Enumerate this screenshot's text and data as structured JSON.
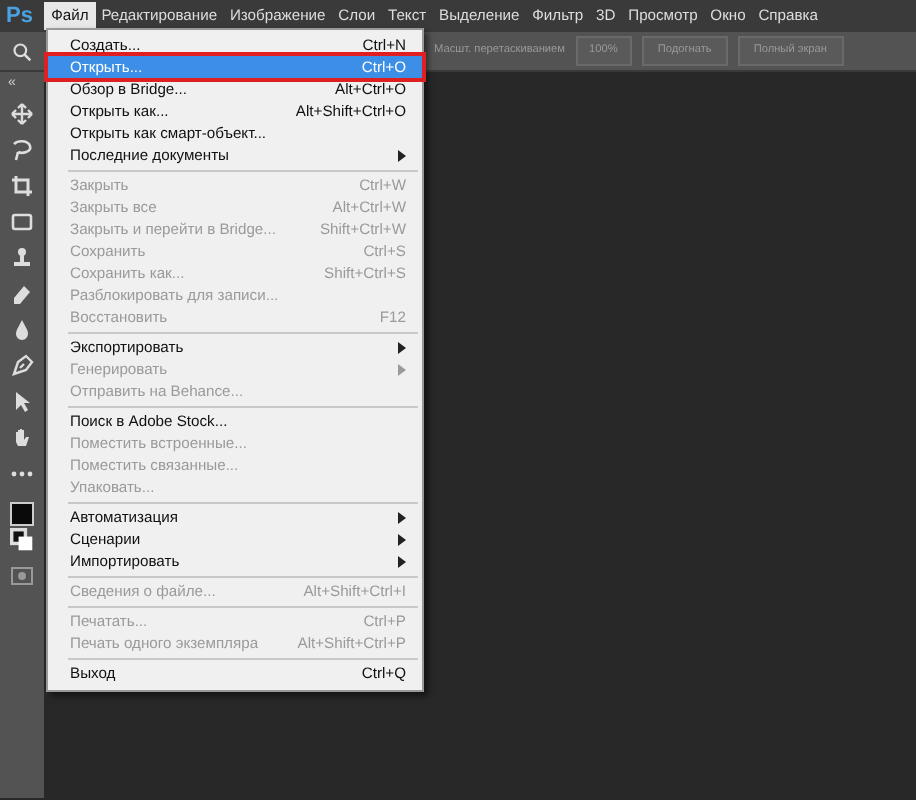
{
  "app_logo": "Ps",
  "menubar": [
    {
      "label": "Файл",
      "selected": true
    },
    {
      "label": "Редактирование",
      "selected": false
    },
    {
      "label": "Изображение",
      "selected": false
    },
    {
      "label": "Слои",
      "selected": false
    },
    {
      "label": "Текст",
      "selected": false
    },
    {
      "label": "Выделение",
      "selected": false
    },
    {
      "label": "Фильтр",
      "selected": false
    },
    {
      "label": "3D",
      "selected": false
    },
    {
      "label": "Просмотр",
      "selected": false
    },
    {
      "label": "Окно",
      "selected": false
    },
    {
      "label": "Справка",
      "selected": false
    }
  ],
  "options_bar": {
    "checkbox_label": "Масшт. перетаскиванием",
    "buttons": [
      "100%",
      "Подогнать",
      "Полный экран"
    ]
  },
  "panel_collapse": "«",
  "file_menu": [
    {
      "kind": "item",
      "label": "Создать...",
      "shortcut": "Ctrl+N",
      "disabled": false,
      "selected": false,
      "submenu": false,
      "annotated": false
    },
    {
      "kind": "item",
      "label": "Открыть...",
      "shortcut": "Ctrl+O",
      "disabled": false,
      "selected": true,
      "submenu": false,
      "annotated": true
    },
    {
      "kind": "item",
      "label": "Обзор в Bridge...",
      "shortcut": "Alt+Ctrl+O",
      "disabled": false,
      "selected": false,
      "submenu": false,
      "annotated": false
    },
    {
      "kind": "item",
      "label": "Открыть как...",
      "shortcut": "Alt+Shift+Ctrl+O",
      "disabled": false,
      "selected": false,
      "submenu": false,
      "annotated": false
    },
    {
      "kind": "item",
      "label": "Открыть как смарт-объект...",
      "disabled": false,
      "selected": false,
      "submenu": false,
      "annotated": false
    },
    {
      "kind": "item",
      "label": "Последние документы",
      "disabled": false,
      "selected": false,
      "submenu": true,
      "annotated": false
    },
    {
      "kind": "separator"
    },
    {
      "kind": "item",
      "label": "Закрыть",
      "shortcut": "Ctrl+W",
      "disabled": true,
      "selected": false,
      "submenu": false,
      "annotated": false
    },
    {
      "kind": "item",
      "label": "Закрыть все",
      "shortcut": "Alt+Ctrl+W",
      "disabled": true,
      "selected": false,
      "submenu": false,
      "annotated": false
    },
    {
      "kind": "item",
      "label": "Закрыть и перейти в Bridge...",
      "shortcut": "Shift+Ctrl+W",
      "disabled": true,
      "selected": false,
      "submenu": false,
      "annotated": false
    },
    {
      "kind": "item",
      "label": "Сохранить",
      "shortcut": "Ctrl+S",
      "disabled": true,
      "selected": false,
      "submenu": false,
      "annotated": false
    },
    {
      "kind": "item",
      "label": "Сохранить как...",
      "shortcut": "Shift+Ctrl+S",
      "disabled": true,
      "selected": false,
      "submenu": false,
      "annotated": false
    },
    {
      "kind": "item",
      "label": "Разблокировать для записи...",
      "disabled": true,
      "selected": false,
      "submenu": false,
      "annotated": false
    },
    {
      "kind": "item",
      "label": "Восстановить",
      "shortcut": "F12",
      "disabled": true,
      "selected": false,
      "submenu": false,
      "annotated": false
    },
    {
      "kind": "separator"
    },
    {
      "kind": "item",
      "label": "Экспортировать",
      "disabled": false,
      "selected": false,
      "submenu": true,
      "annotated": false
    },
    {
      "kind": "item",
      "label": "Генерировать",
      "disabled": true,
      "selected": false,
      "submenu": true,
      "annotated": false
    },
    {
      "kind": "item",
      "label": "Отправить на Behance...",
      "disabled": true,
      "selected": false,
      "submenu": false,
      "annotated": false
    },
    {
      "kind": "separator"
    },
    {
      "kind": "item",
      "label": "Поиск в Adobe Stock...",
      "disabled": false,
      "selected": false,
      "submenu": false,
      "annotated": false
    },
    {
      "kind": "item",
      "label": "Поместить встроенные...",
      "disabled": true,
      "selected": false,
      "submenu": false,
      "annotated": false
    },
    {
      "kind": "item",
      "label": "Поместить связанные...",
      "disabled": true,
      "selected": false,
      "submenu": false,
      "annotated": false
    },
    {
      "kind": "item",
      "label": "Упаковать...",
      "disabled": true,
      "selected": false,
      "submenu": false,
      "annotated": false
    },
    {
      "kind": "separator"
    },
    {
      "kind": "item",
      "label": "Автоматизация",
      "disabled": false,
      "selected": false,
      "submenu": true,
      "annotated": false
    },
    {
      "kind": "item",
      "label": "Сценарии",
      "disabled": false,
      "selected": false,
      "submenu": true,
      "annotated": false
    },
    {
      "kind": "item",
      "label": "Импортировать",
      "disabled": false,
      "selected": false,
      "submenu": true,
      "annotated": false
    },
    {
      "kind": "separator"
    },
    {
      "kind": "item",
      "label": "Сведения о файле...",
      "shortcut": "Alt+Shift+Ctrl+I",
      "disabled": true,
      "selected": false,
      "submenu": false,
      "annotated": false
    },
    {
      "kind": "separator"
    },
    {
      "kind": "item",
      "label": "Печатать...",
      "shortcut": "Ctrl+P",
      "disabled": true,
      "selected": false,
      "submenu": false,
      "annotated": false
    },
    {
      "kind": "item",
      "label": "Печать одного экземпляра",
      "shortcut": "Alt+Shift+Ctrl+P",
      "disabled": true,
      "selected": false,
      "submenu": false,
      "annotated": false
    },
    {
      "kind": "separator"
    },
    {
      "kind": "item",
      "label": "Выход",
      "shortcut": "Ctrl+Q",
      "disabled": false,
      "selected": false,
      "submenu": false,
      "annotated": false
    }
  ]
}
